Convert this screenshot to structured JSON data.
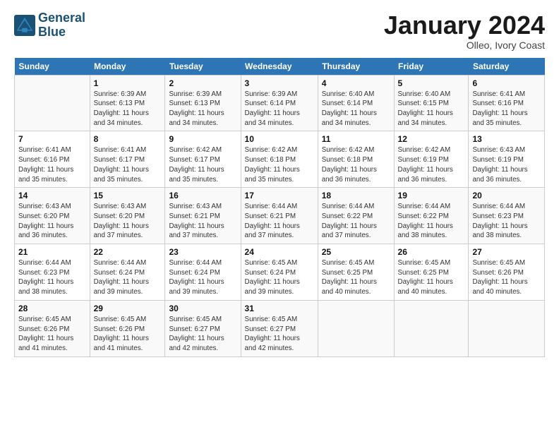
{
  "logo": {
    "line1": "General",
    "line2": "Blue"
  },
  "header": {
    "title": "January 2024",
    "subtitle": "Olleo, Ivory Coast"
  },
  "weekdays": [
    "Sunday",
    "Monday",
    "Tuesday",
    "Wednesday",
    "Thursday",
    "Friday",
    "Saturday"
  ],
  "weeks": [
    [
      {
        "num": "",
        "info": ""
      },
      {
        "num": "1",
        "info": "Sunrise: 6:39 AM\nSunset: 6:13 PM\nDaylight: 11 hours\nand 34 minutes."
      },
      {
        "num": "2",
        "info": "Sunrise: 6:39 AM\nSunset: 6:13 PM\nDaylight: 11 hours\nand 34 minutes."
      },
      {
        "num": "3",
        "info": "Sunrise: 6:39 AM\nSunset: 6:14 PM\nDaylight: 11 hours\nand 34 minutes."
      },
      {
        "num": "4",
        "info": "Sunrise: 6:40 AM\nSunset: 6:14 PM\nDaylight: 11 hours\nand 34 minutes."
      },
      {
        "num": "5",
        "info": "Sunrise: 6:40 AM\nSunset: 6:15 PM\nDaylight: 11 hours\nand 34 minutes."
      },
      {
        "num": "6",
        "info": "Sunrise: 6:41 AM\nSunset: 6:16 PM\nDaylight: 11 hours\nand 35 minutes."
      }
    ],
    [
      {
        "num": "7",
        "info": "Sunrise: 6:41 AM\nSunset: 6:16 PM\nDaylight: 11 hours\nand 35 minutes."
      },
      {
        "num": "8",
        "info": "Sunrise: 6:41 AM\nSunset: 6:17 PM\nDaylight: 11 hours\nand 35 minutes."
      },
      {
        "num": "9",
        "info": "Sunrise: 6:42 AM\nSunset: 6:17 PM\nDaylight: 11 hours\nand 35 minutes."
      },
      {
        "num": "10",
        "info": "Sunrise: 6:42 AM\nSunset: 6:18 PM\nDaylight: 11 hours\nand 35 minutes."
      },
      {
        "num": "11",
        "info": "Sunrise: 6:42 AM\nSunset: 6:18 PM\nDaylight: 11 hours\nand 36 minutes."
      },
      {
        "num": "12",
        "info": "Sunrise: 6:42 AM\nSunset: 6:19 PM\nDaylight: 11 hours\nand 36 minutes."
      },
      {
        "num": "13",
        "info": "Sunrise: 6:43 AM\nSunset: 6:19 PM\nDaylight: 11 hours\nand 36 minutes."
      }
    ],
    [
      {
        "num": "14",
        "info": "Sunrise: 6:43 AM\nSunset: 6:20 PM\nDaylight: 11 hours\nand 36 minutes."
      },
      {
        "num": "15",
        "info": "Sunrise: 6:43 AM\nSunset: 6:20 PM\nDaylight: 11 hours\nand 37 minutes."
      },
      {
        "num": "16",
        "info": "Sunrise: 6:43 AM\nSunset: 6:21 PM\nDaylight: 11 hours\nand 37 minutes."
      },
      {
        "num": "17",
        "info": "Sunrise: 6:44 AM\nSunset: 6:21 PM\nDaylight: 11 hours\nand 37 minutes."
      },
      {
        "num": "18",
        "info": "Sunrise: 6:44 AM\nSunset: 6:22 PM\nDaylight: 11 hours\nand 37 minutes."
      },
      {
        "num": "19",
        "info": "Sunrise: 6:44 AM\nSunset: 6:22 PM\nDaylight: 11 hours\nand 38 minutes."
      },
      {
        "num": "20",
        "info": "Sunrise: 6:44 AM\nSunset: 6:23 PM\nDaylight: 11 hours\nand 38 minutes."
      }
    ],
    [
      {
        "num": "21",
        "info": "Sunrise: 6:44 AM\nSunset: 6:23 PM\nDaylight: 11 hours\nand 38 minutes."
      },
      {
        "num": "22",
        "info": "Sunrise: 6:44 AM\nSunset: 6:24 PM\nDaylight: 11 hours\nand 39 minutes."
      },
      {
        "num": "23",
        "info": "Sunrise: 6:44 AM\nSunset: 6:24 PM\nDaylight: 11 hours\nand 39 minutes."
      },
      {
        "num": "24",
        "info": "Sunrise: 6:45 AM\nSunset: 6:24 PM\nDaylight: 11 hours\nand 39 minutes."
      },
      {
        "num": "25",
        "info": "Sunrise: 6:45 AM\nSunset: 6:25 PM\nDaylight: 11 hours\nand 40 minutes."
      },
      {
        "num": "26",
        "info": "Sunrise: 6:45 AM\nSunset: 6:25 PM\nDaylight: 11 hours\nand 40 minutes."
      },
      {
        "num": "27",
        "info": "Sunrise: 6:45 AM\nSunset: 6:26 PM\nDaylight: 11 hours\nand 40 minutes."
      }
    ],
    [
      {
        "num": "28",
        "info": "Sunrise: 6:45 AM\nSunset: 6:26 PM\nDaylight: 11 hours\nand 41 minutes."
      },
      {
        "num": "29",
        "info": "Sunrise: 6:45 AM\nSunset: 6:26 PM\nDaylight: 11 hours\nand 41 minutes."
      },
      {
        "num": "30",
        "info": "Sunrise: 6:45 AM\nSunset: 6:27 PM\nDaylight: 11 hours\nand 42 minutes."
      },
      {
        "num": "31",
        "info": "Sunrise: 6:45 AM\nSunset: 6:27 PM\nDaylight: 11 hours\nand 42 minutes."
      },
      {
        "num": "",
        "info": ""
      },
      {
        "num": "",
        "info": ""
      },
      {
        "num": "",
        "info": ""
      }
    ]
  ]
}
